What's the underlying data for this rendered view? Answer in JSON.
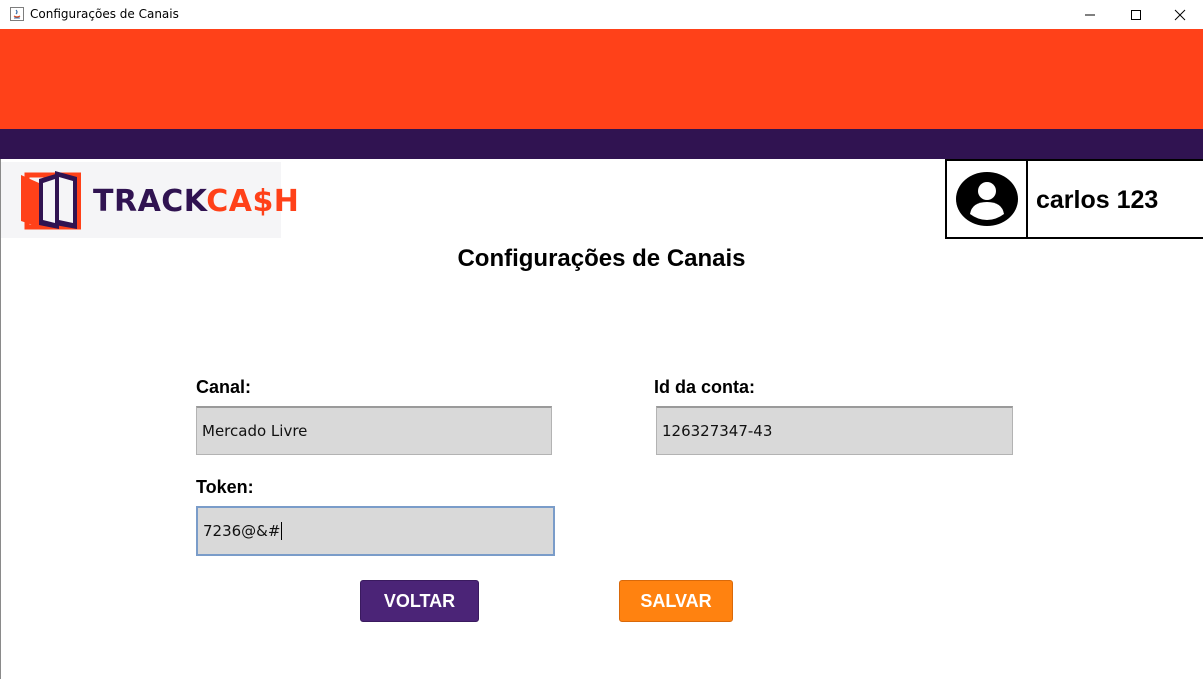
{
  "window": {
    "title": "Configurações de Canais"
  },
  "header": {
    "logo": {
      "part1": "TRACK",
      "part2": "CA$H",
      "icon": "door-frame-logo-icon"
    },
    "user": {
      "name": "carlos 123",
      "avatar_icon": "user-circle-icon"
    }
  },
  "page": {
    "title": "Configurações de Canais"
  },
  "form": {
    "canal": {
      "label": "Canal:",
      "value": "Mercado Livre"
    },
    "id_conta": {
      "label": "Id da conta:",
      "value": "126327347-43"
    },
    "token": {
      "label": "Token:",
      "value": "7236@&#"
    }
  },
  "buttons": {
    "voltar": "VOLTAR",
    "salvar": "SALVAR"
  },
  "colors": {
    "banner_orange": "#ff4119",
    "banner_purple": "#301351",
    "voltar_button": "#4b2477",
    "salvar_button": "#ff8210",
    "field_bg": "#d9d9d9"
  }
}
